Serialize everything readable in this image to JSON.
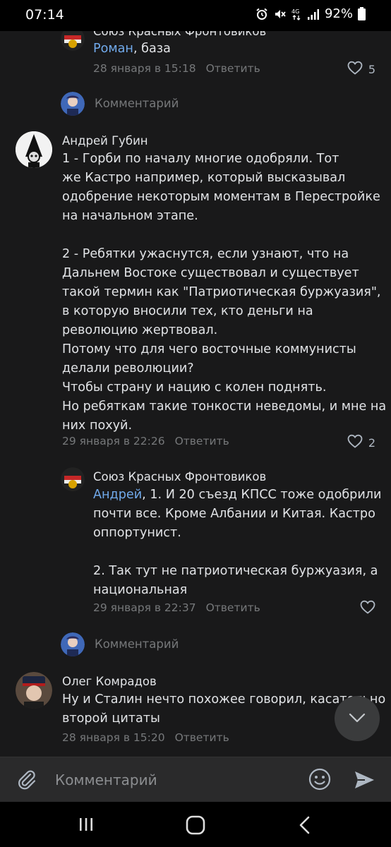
{
  "status": {
    "time": "07:14",
    "battery": "92%",
    "network": "4G"
  },
  "comments": [
    {
      "author": "Союз Красных Фронтовиков",
      "mention": "Роман",
      "text": ", база",
      "date": "28 января в 15:18",
      "reply": "Ответить",
      "likes": "5"
    },
    {
      "author": "Андрей Губин",
      "text": "1 - Горби по началу многие одобряли. Тот\nже Кастро например, который высказывал\nодобрение некоторым моментам в Перестройке\nна начальном этапе.\n\n2 - Ребятки ужаснутся, если узнают, что на\nДальнем Востоке существовал и существует\nтакой термин как \"Патриотическая буржуазия\",\nв которую вносили тех, кто деньги на\nреволюцию жертвовал.\nПотому что для чего восточные коммунисты\nделали революции?\nЧтобы страну и нацию с колен поднять.\nНо ребяткам такие тонкости неведомы, и мне на\nних похуй.",
      "date": "29 января в 22:26",
      "reply": "Ответить",
      "likes": "2"
    },
    {
      "author": "Союз Красных Фронтовиков",
      "mention": "Андрей",
      "text": ", 1. И 20 съезд КПСС тоже одобрили\nпочти все. Кроме Албании и Китая. Кастро\nоппортунист.\n\n2. Так тут не патриотическая буржуазия, а\nнациональная",
      "date": "29 января в 22:37",
      "reply": "Ответить"
    },
    {
      "author": "Олег Комрадов",
      "text": "Ну и Сталин нечто похожее говорил, касательно\nвторой цитаты",
      "date": "28 января в 15:20",
      "reply": "Ответить"
    }
  ],
  "reply_prompt": "Комментарий",
  "composer": {
    "placeholder": "Комментарий"
  },
  "icons": [
    "alarm-icon",
    "mute-icon",
    "network-icon",
    "signal-icon",
    "battery-icon",
    "heart-icon",
    "chevron-down-icon",
    "paperclip-icon",
    "emoji-icon",
    "send-icon",
    "recents-icon",
    "home-icon",
    "back-icon"
  ],
  "colors": {
    "background": "#19191a",
    "link": "#71aaeb",
    "secondary": "#76787a"
  }
}
